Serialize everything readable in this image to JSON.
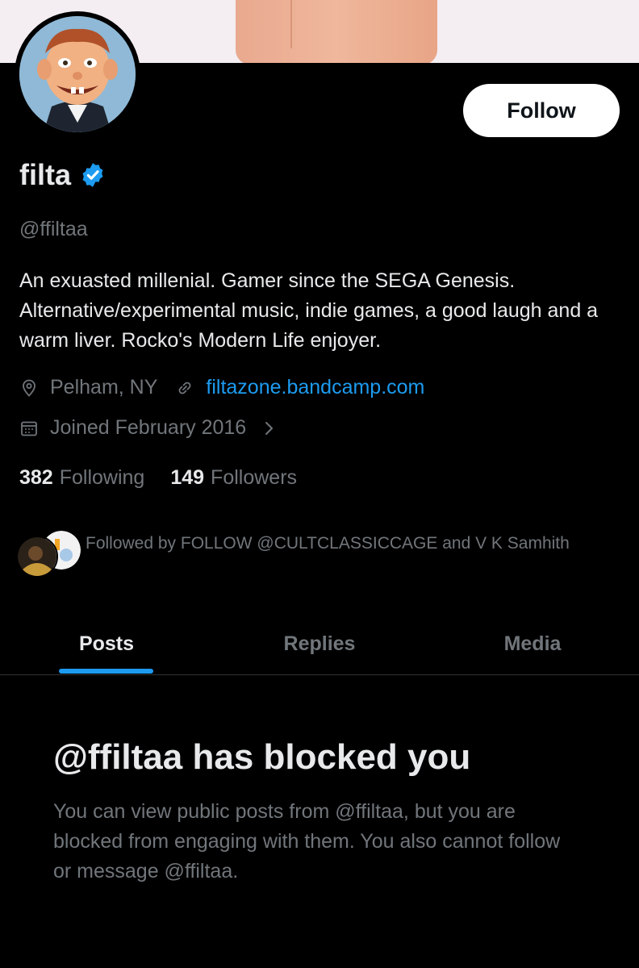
{
  "profile": {
    "name": "filta",
    "handle": "@ffiltaa",
    "follow_label": "Follow",
    "bio": "An exuasted millenial. Gamer since the SEGA Genesis. Alternative/experimental music, indie games, a good laugh and a warm liver. Rocko's Modern Life enjoyer.",
    "location": "Pelham, NY",
    "website": "filtazone.bandcamp.com",
    "joined": "Joined February 2016",
    "following_count": "382",
    "following_label": "Following",
    "followers_count": "149",
    "followers_label": "Followers",
    "followed_by": "Followed by FOLLOW @CULTCLASSICCAGE and V K Samhith"
  },
  "tabs": [
    {
      "label": "Posts",
      "active": true
    },
    {
      "label": "Replies",
      "active": false
    },
    {
      "label": "Media",
      "active": false
    }
  ],
  "blocked": {
    "title": "@ffiltaa has blocked you",
    "body": "You can view public posts from @ffiltaa, but you are blocked from engaging with them. You also cannot follow or message @ffiltaa."
  },
  "colors": {
    "background": "#000000",
    "accent": "#1d9bf0",
    "secondary_text": "#71767b",
    "primary_text": "#e7e9ea"
  }
}
